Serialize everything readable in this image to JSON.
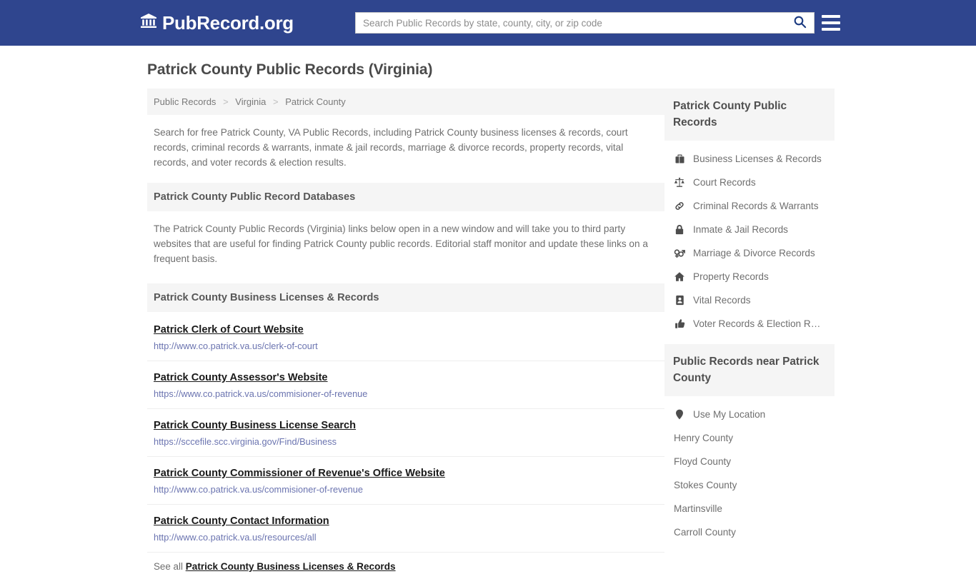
{
  "header": {
    "brand": "PubRecord.org",
    "brand_icon": "bank-icon",
    "search_placeholder": "Search Public Records by state, county, city, or zip code",
    "search_value": "",
    "search_icon": "search-icon",
    "menu_icon": "hamburger-menu-icon"
  },
  "page": {
    "title": "Patrick County Public Records (Virginia)"
  },
  "breadcrumb": {
    "items": [
      "Public Records",
      "Virginia",
      "Patrick County"
    ],
    "separator": ">"
  },
  "intro": "Search for free Patrick County, VA Public Records, including Patrick County business licenses & records, court records, criminal records & warrants, inmate & jail records, marriage & divorce records, property records, vital records, and voter records & election results.",
  "databases": {
    "heading": "Patrick County Public Record Databases",
    "text": "The Patrick County Public Records (Virginia) links below open in a new window and will take you to third party websites that are useful for finding Patrick County public records. Editorial staff monitor and update these links on a frequent basis."
  },
  "business": {
    "heading": "Patrick County Business Licenses & Records",
    "links": [
      {
        "title": "Patrick Clerk of Court Website",
        "url": "http://www.co.patrick.va.us/clerk-of-court"
      },
      {
        "title": "Patrick County Assessor's Website",
        "url": "https://www.co.patrick.va.us/commisioner-of-revenue"
      },
      {
        "title": "Patrick County Business License Search",
        "url": "https://sccefile.scc.virginia.gov/Find/Business"
      },
      {
        "title": "Patrick County Commissioner of Revenue's Office Website",
        "url": "http://www.co.patrick.va.us/commisioner-of-revenue"
      },
      {
        "title": "Patrick County Contact Information",
        "url": "http://www.co.patrick.va.us/resources/all"
      }
    ],
    "see_all_prefix": "See all",
    "see_all_link": "Patrick County Business Licenses & Records"
  },
  "sidebar": {
    "records_heading": "Patrick County Public Records",
    "records_items": [
      {
        "label": "Business Licenses & Records",
        "icon": "briefcase-icon"
      },
      {
        "label": "Court Records",
        "icon": "balance-scale-icon"
      },
      {
        "label": "Criminal Records & Warrants",
        "icon": "chain-link-icon"
      },
      {
        "label": "Inmate & Jail Records",
        "icon": "lock-icon"
      },
      {
        "label": "Marriage & Divorce Records",
        "icon": "venus-mars-icon"
      },
      {
        "label": "Property Records",
        "icon": "home-icon"
      },
      {
        "label": "Vital Records",
        "icon": "id-badge-icon"
      },
      {
        "label": "Voter Records & Election R…",
        "icon": "thumbs-up-icon"
      }
    ],
    "near_heading": "Public Records near Patrick County",
    "near_items": [
      {
        "label": "Use My Location",
        "icon": "map-pin-icon"
      },
      {
        "label": "Henry County",
        "icon": ""
      },
      {
        "label": "Floyd County",
        "icon": ""
      },
      {
        "label": "Stokes County",
        "icon": ""
      },
      {
        "label": "Martinsville",
        "icon": ""
      },
      {
        "label": "Carroll County",
        "icon": ""
      }
    ]
  },
  "colors": {
    "header_blue": "#2F458E",
    "panel_gray": "#f5f5f5",
    "link_url_blue": "#6b74b0",
    "body_text": "#6f6f6f"
  }
}
